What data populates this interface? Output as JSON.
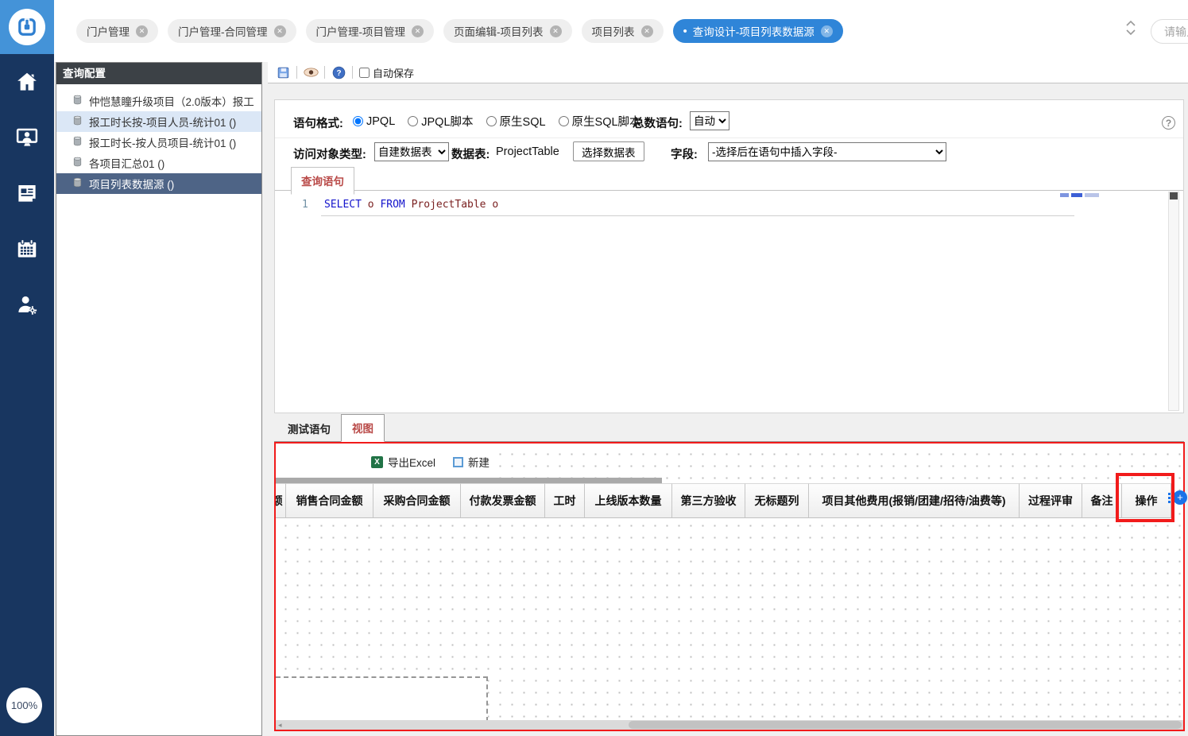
{
  "app": {
    "zoom_level": "100%"
  },
  "topbar": {
    "tabs": [
      {
        "label": "门户管理",
        "active": false
      },
      {
        "label": "门户管理-合同管理",
        "active": false
      },
      {
        "label": "门户管理-项目管理",
        "active": false
      },
      {
        "label": "页面编辑-项目列表",
        "active": false
      },
      {
        "label": "项目列表",
        "active": false
      },
      {
        "label": "查询设计-项目列表数据源",
        "active": true
      }
    ],
    "search_placeholder": "请输入搜索关键字"
  },
  "sidebar": {
    "icons": [
      "home-icon",
      "user-monitor-icon",
      "news-icon",
      "calendar-icon",
      "user-settings-icon"
    ]
  },
  "left_panel": {
    "title": "查询配置",
    "items": [
      {
        "label": "仲恺慧瞳升级项目（2.0版本）报工",
        "state": "normal"
      },
      {
        "label": "报工时长按-项目人员-统计01 ()",
        "state": "hover"
      },
      {
        "label": "报工时长-按人员项目-统计01 ()",
        "state": "normal"
      },
      {
        "label": "各项目汇总01 ()",
        "state": "normal"
      },
      {
        "label": "项目列表数据源 ()",
        "state": "selected"
      }
    ]
  },
  "toolbar": {
    "autosave_label": "自动保存"
  },
  "form": {
    "statement_format_label": "语句格式:",
    "radios": [
      {
        "label": "JPQL",
        "checked": true
      },
      {
        "label": "JPQL脚本",
        "checked": false
      },
      {
        "label": "原生SQL",
        "checked": false
      },
      {
        "label": "原生SQL脚本",
        "checked": false
      }
    ],
    "total_label": "总数语句:",
    "total_value": "自动",
    "access_type_label": "访问对象类型:",
    "access_type_value": "自建数据表",
    "table_label": "数据表:",
    "table_value": "ProjectTable",
    "select_table_button": "选择数据表",
    "field_label": "字段:",
    "field_value": "-选择后在语句中插入字段-",
    "query_tab": "查询语句",
    "code_line_number": "1",
    "code_tokens": [
      {
        "text": "SELECT",
        "type": "kw"
      },
      {
        "text": " o ",
        "type": "id"
      },
      {
        "text": "FROM",
        "type": "kw"
      },
      {
        "text": " ProjectTable o",
        "type": "id"
      }
    ]
  },
  "bottom": {
    "tabs": [
      {
        "label": "测试语句",
        "active": false
      },
      {
        "label": "视图",
        "active": true
      }
    ],
    "export_button": "导出Excel",
    "new_button": "新建",
    "columns": [
      "额",
      "销售合同金额",
      "采购合同金额",
      "付款发票金额",
      "工时",
      "上线版本数量",
      "第三方验收",
      "无标题列",
      "项目其他费用(报销/团建/招待/油费等)",
      "过程评审",
      "备注",
      "操作"
    ]
  },
  "colors": {
    "sidebar_navy": "#183660",
    "logo_blue": "#4493d8",
    "active_tab_blue": "#2f85d8",
    "selected_tree_blue": "#4e6486",
    "tab_red": "#b94a48",
    "annotation_red": "#f11b1b",
    "keyword_blue": "#1414cc",
    "identifier_maroon": "#7a2020",
    "excel_green": "#217346",
    "new_button_blue": "#5b9bd5"
  }
}
